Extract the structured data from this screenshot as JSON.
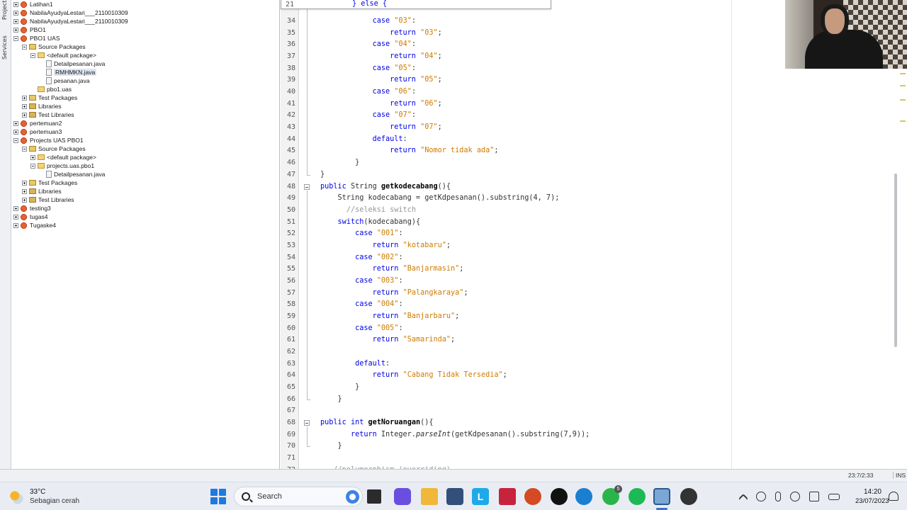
{
  "side_tabs": {
    "projects": "Projects",
    "services": "Services"
  },
  "project_tree": [
    {
      "label": "Latihan1",
      "type": "project",
      "level": 0,
      "expanded": false
    },
    {
      "label": "NabilaAyudyaLestari___2110010309",
      "type": "project",
      "level": 0,
      "expanded": false
    },
    {
      "label": "NabilaAyudyaLestari___2110010309",
      "type": "project",
      "level": 0,
      "expanded": false
    },
    {
      "label": "PBO1",
      "type": "project",
      "level": 0,
      "expanded": false
    },
    {
      "label": "PBO1 UAS",
      "type": "project",
      "level": 0,
      "expanded": true
    },
    {
      "label": "Source Packages",
      "type": "srcpkg",
      "level": 1,
      "expanded": true
    },
    {
      "label": "<default package>",
      "type": "package",
      "level": 2,
      "expanded": true
    },
    {
      "label": "Detailpesanan.java",
      "type": "file",
      "level": 3
    },
    {
      "label": "RMHMKN.java",
      "type": "file",
      "level": 3,
      "selected": true
    },
    {
      "label": "pesanan.java",
      "type": "file",
      "level": 3
    },
    {
      "label": "pbo1.uas",
      "type": "package",
      "level": 2
    },
    {
      "label": "Test Packages",
      "type": "srcpkg",
      "level": 1,
      "expanded": false
    },
    {
      "label": "Libraries",
      "type": "libs",
      "level": 1,
      "expanded": false
    },
    {
      "label": "Test Libraries",
      "type": "libs",
      "level": 1,
      "expanded": false
    },
    {
      "label": "pertemuan2",
      "type": "project",
      "level": 0,
      "expanded": false
    },
    {
      "label": "pertemuan3",
      "type": "project",
      "level": 0,
      "expanded": false
    },
    {
      "label": "Projects UAS PBO1",
      "type": "project",
      "level": 0,
      "expanded": true
    },
    {
      "label": "Source Packages",
      "type": "srcpkg",
      "level": 1,
      "expanded": true
    },
    {
      "label": "<default package>",
      "type": "package",
      "level": 2,
      "expanded": false
    },
    {
      "label": "projects.uas.pbo1",
      "type": "package",
      "level": 2,
      "expanded": true
    },
    {
      "label": "Detailpesanan.java",
      "type": "file",
      "level": 3
    },
    {
      "label": "Test Packages",
      "type": "srcpkg",
      "level": 1,
      "expanded": false
    },
    {
      "label": "Libraries",
      "type": "libs",
      "level": 1,
      "expanded": false
    },
    {
      "label": "Test Libraries",
      "type": "libs",
      "level": 1,
      "expanded": false
    },
    {
      "label": "testing3",
      "type": "project",
      "level": 0,
      "expanded": false
    },
    {
      "label": "tugas4",
      "type": "project",
      "level": 0,
      "expanded": false
    },
    {
      "label": "Tugaske4",
      "type": "project",
      "level": 0,
      "expanded": false
    }
  ],
  "editor": {
    "popup_line_number": "21",
    "popup_text": "} else {",
    "lines": [
      {
        "n": "34",
        "segs": [
          [
            "",
            "            "
          ],
          [
            "kw",
            "case"
          ],
          [
            "",
            " "
          ],
          [
            "str",
            "\"03\""
          ],
          [
            "",
            ":"
          ]
        ]
      },
      {
        "n": "35",
        "segs": [
          [
            "",
            "                "
          ],
          [
            "kw",
            "return"
          ],
          [
            "",
            " "
          ],
          [
            "str",
            "\"03\""
          ],
          [
            "",
            ";"
          ]
        ]
      },
      {
        "n": "36",
        "segs": [
          [
            "",
            "            "
          ],
          [
            "kw",
            "case"
          ],
          [
            "",
            " "
          ],
          [
            "str",
            "\"04\""
          ],
          [
            "",
            ":"
          ]
        ]
      },
      {
        "n": "37",
        "segs": [
          [
            "",
            "                "
          ],
          [
            "kw",
            "return"
          ],
          [
            "",
            " "
          ],
          [
            "str",
            "\"04\""
          ],
          [
            "",
            ";"
          ]
        ]
      },
      {
        "n": "38",
        "segs": [
          [
            "",
            "            "
          ],
          [
            "kw",
            "case"
          ],
          [
            "",
            " "
          ],
          [
            "str",
            "\"05\""
          ],
          [
            "",
            ":"
          ]
        ]
      },
      {
        "n": "39",
        "segs": [
          [
            "",
            "                "
          ],
          [
            "kw",
            "return"
          ],
          [
            "",
            " "
          ],
          [
            "str",
            "\"05\""
          ],
          [
            "",
            ";"
          ]
        ]
      },
      {
        "n": "40",
        "segs": [
          [
            "",
            "            "
          ],
          [
            "kw",
            "case"
          ],
          [
            "",
            " "
          ],
          [
            "str",
            "\"06\""
          ],
          [
            "",
            ":"
          ]
        ]
      },
      {
        "n": "41",
        "segs": [
          [
            "",
            "                "
          ],
          [
            "kw",
            "return"
          ],
          [
            "",
            " "
          ],
          [
            "str",
            "\"06\""
          ],
          [
            "",
            ";"
          ]
        ]
      },
      {
        "n": "42",
        "segs": [
          [
            "",
            "            "
          ],
          [
            "kw",
            "case"
          ],
          [
            "",
            " "
          ],
          [
            "str",
            "\"07\""
          ],
          [
            "",
            ":"
          ]
        ]
      },
      {
        "n": "43",
        "segs": [
          [
            "",
            "                "
          ],
          [
            "kw",
            "return"
          ],
          [
            "",
            " "
          ],
          [
            "str",
            "\"07\""
          ],
          [
            "",
            ";"
          ]
        ]
      },
      {
        "n": "44",
        "segs": [
          [
            "",
            "            "
          ],
          [
            "kw",
            "default"
          ],
          [
            "",
            ":"
          ]
        ]
      },
      {
        "n": "45",
        "segs": [
          [
            "",
            "                "
          ],
          [
            "kw",
            "return"
          ],
          [
            "",
            " "
          ],
          [
            "str",
            "\"Nomor tidak ada\""
          ],
          [
            "",
            ";"
          ]
        ]
      },
      {
        "n": "46",
        "segs": [
          [
            "",
            "        }"
          ]
        ]
      },
      {
        "n": "47",
        "segs": [
          [
            "",
            "}"
          ]
        ]
      },
      {
        "n": "48",
        "segs": [
          [
            "kw",
            "public"
          ],
          [
            "",
            " String "
          ],
          [
            "mth",
            "getkodecabang"
          ],
          [
            "",
            "(){"
          ]
        ]
      },
      {
        "n": "49",
        "segs": [
          [
            "",
            "    String kodecabang = getKdpesanan().substring(4, 7);"
          ]
        ]
      },
      {
        "n": "50",
        "segs": [
          [
            "",
            "      "
          ],
          [
            "cm",
            "//seleksi switch"
          ]
        ]
      },
      {
        "n": "51",
        "segs": [
          [
            "",
            "    "
          ],
          [
            "kw",
            "switch"
          ],
          [
            "",
            "(kodecabang){"
          ]
        ]
      },
      {
        "n": "52",
        "segs": [
          [
            "",
            "        "
          ],
          [
            "kw",
            "case"
          ],
          [
            "",
            " "
          ],
          [
            "str",
            "\"001\""
          ],
          [
            "",
            ":"
          ]
        ]
      },
      {
        "n": "53",
        "segs": [
          [
            "",
            "            "
          ],
          [
            "kw",
            "return"
          ],
          [
            "",
            " "
          ],
          [
            "str",
            "\"kotabaru\""
          ],
          [
            "",
            ";"
          ]
        ]
      },
      {
        "n": "54",
        "segs": [
          [
            "",
            "        "
          ],
          [
            "kw",
            "case"
          ],
          [
            "",
            " "
          ],
          [
            "str",
            "\"002\""
          ],
          [
            "",
            ":"
          ]
        ]
      },
      {
        "n": "55",
        "segs": [
          [
            "",
            "            "
          ],
          [
            "kw",
            "return"
          ],
          [
            "",
            " "
          ],
          [
            "str",
            "\"Banjarmasin\""
          ],
          [
            "",
            ";"
          ]
        ]
      },
      {
        "n": "56",
        "segs": [
          [
            "",
            "        "
          ],
          [
            "kw",
            "case"
          ],
          [
            "",
            " "
          ],
          [
            "str",
            "\"003\""
          ],
          [
            "",
            ":"
          ]
        ]
      },
      {
        "n": "57",
        "segs": [
          [
            "",
            "            "
          ],
          [
            "kw",
            "return"
          ],
          [
            "",
            " "
          ],
          [
            "str",
            "\"Palangkaraya\""
          ],
          [
            "",
            ";"
          ]
        ]
      },
      {
        "n": "58",
        "segs": [
          [
            "",
            "        "
          ],
          [
            "kw",
            "case"
          ],
          [
            "",
            " "
          ],
          [
            "str",
            "\"004\""
          ],
          [
            "",
            ":"
          ]
        ]
      },
      {
        "n": "59",
        "segs": [
          [
            "",
            "            "
          ],
          [
            "kw",
            "return"
          ],
          [
            "",
            " "
          ],
          [
            "str",
            "\"Banjarbaru\""
          ],
          [
            "",
            ";"
          ]
        ]
      },
      {
        "n": "60",
        "segs": [
          [
            "",
            "        "
          ],
          [
            "kw",
            "case"
          ],
          [
            "",
            " "
          ],
          [
            "str",
            "\"005\""
          ],
          [
            "",
            ":"
          ]
        ]
      },
      {
        "n": "61",
        "segs": [
          [
            "",
            "            "
          ],
          [
            "kw",
            "return"
          ],
          [
            "",
            " "
          ],
          [
            "str",
            "\"Samarinda\""
          ],
          [
            "",
            ";"
          ]
        ]
      },
      {
        "n": "62",
        "segs": [
          [
            "",
            ""
          ]
        ]
      },
      {
        "n": "63",
        "segs": [
          [
            "",
            "        "
          ],
          [
            "kw",
            "default"
          ],
          [
            "",
            ":"
          ]
        ]
      },
      {
        "n": "64",
        "segs": [
          [
            "",
            "            "
          ],
          [
            "kw",
            "return"
          ],
          [
            "",
            " "
          ],
          [
            "str",
            "\"Cabang Tidak Tersedia\""
          ],
          [
            "",
            ";"
          ]
        ]
      },
      {
        "n": "65",
        "segs": [
          [
            "",
            "        }"
          ]
        ]
      },
      {
        "n": "66",
        "segs": [
          [
            "",
            "    }"
          ]
        ]
      },
      {
        "n": "67",
        "segs": [
          [
            "",
            ""
          ]
        ]
      },
      {
        "n": "68",
        "segs": [
          [
            "kw",
            "public"
          ],
          [
            "",
            " "
          ],
          [
            "kw",
            "int"
          ],
          [
            "",
            " "
          ],
          [
            "mth",
            "getNoruangan"
          ],
          [
            "",
            "(){"
          ]
        ]
      },
      {
        "n": "69",
        "segs": [
          [
            "",
            "       "
          ],
          [
            "kw",
            "return"
          ],
          [
            "",
            " Integer."
          ],
          [
            "itl",
            "parseInt"
          ],
          [
            "",
            "(getKdpesanan().substring(7,9));"
          ]
        ]
      },
      {
        "n": "70",
        "segs": [
          [
            "",
            "    }"
          ]
        ]
      },
      {
        "n": "71",
        "segs": [
          [
            "",
            ""
          ]
        ]
      },
      {
        "n": "72",
        "segs": [
          [
            "",
            "   "
          ],
          [
            "cm",
            "//polymorphism (overriding)"
          ]
        ]
      }
    ]
  },
  "status_bar": {
    "caret_position": "23:7/2:33",
    "insert_mode": "INS"
  },
  "taskbar": {
    "weather_temp": "33°C",
    "weather_desc": "Sebagian cerah",
    "search_label": "Search",
    "apps": [
      {
        "name": "file-explorer-app"
      },
      {
        "name": "teams-app"
      },
      {
        "name": "folder-app"
      },
      {
        "name": "store-app"
      },
      {
        "name": "l-app",
        "letter": "L"
      },
      {
        "name": "mcafee-app"
      },
      {
        "name": "powerpoint-app"
      },
      {
        "name": "tiktok-app"
      },
      {
        "name": "edge-app"
      },
      {
        "name": "whatsapp-app",
        "badge": "5"
      },
      {
        "name": "spotify-app"
      },
      {
        "name": "virtualbox-app"
      },
      {
        "name": "obs-app"
      }
    ],
    "clock_time": "14:20",
    "clock_date": "23/07/2023"
  },
  "colors": {
    "keyword": "#0000e6",
    "string": "#ce7b00",
    "comment": "#969696",
    "accent": "#1f7ae0"
  }
}
